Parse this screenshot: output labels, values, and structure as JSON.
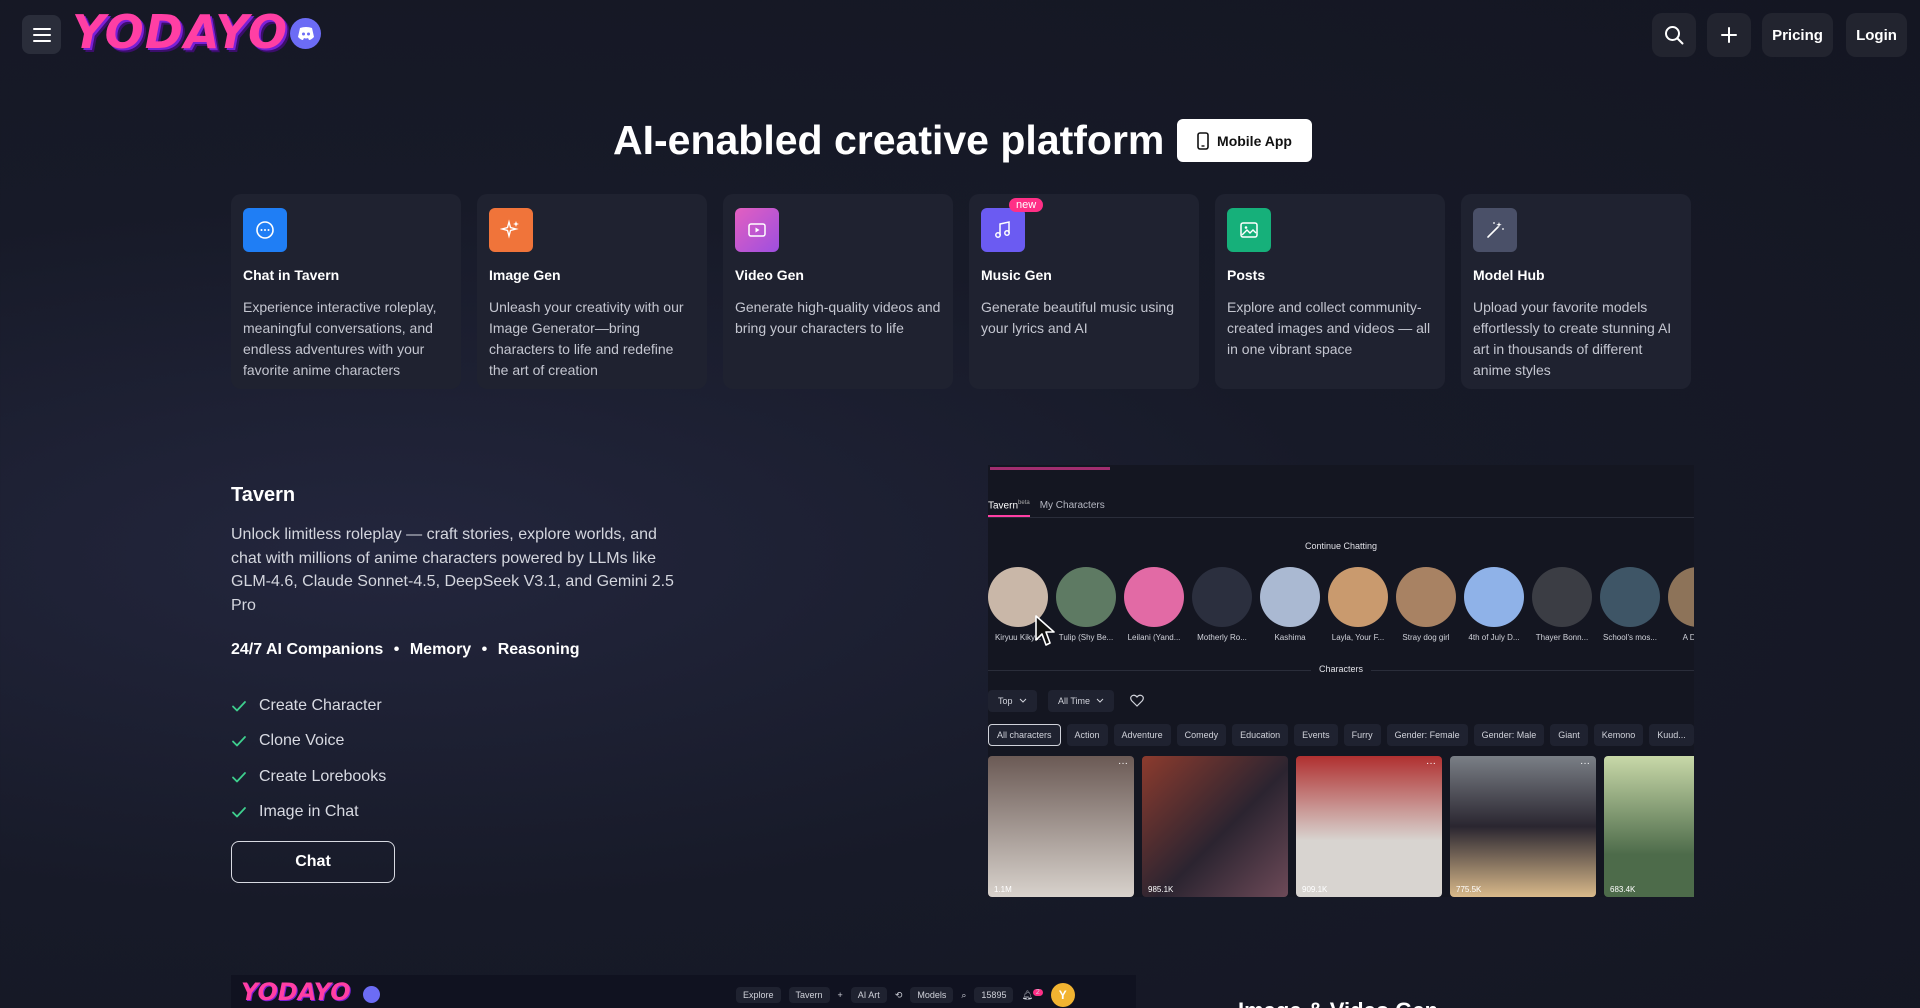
{
  "header": {
    "logo_text": "YODAYO",
    "pricing_label": "Pricing",
    "login_label": "Login"
  },
  "hero": {
    "title": "AI-enabled creative platform",
    "mobile_app_label": "Mobile App"
  },
  "cards": [
    {
      "title": "Chat in Tavern",
      "desc": "Experience interactive roleplay, meaningful conversations, and endless adventures with your favorite anime characters",
      "icon": "chat-bubble-icon",
      "color": "#1f7ef5"
    },
    {
      "title": "Image Gen",
      "desc": "Unleash your creativity with our Image Generator—bring characters to life and redefine the art of creation",
      "icon": "sparkle-icon",
      "color": "#f0743a"
    },
    {
      "title": "Video Gen",
      "desc": "Generate high-quality videos and bring your characters to life",
      "icon": "video-icon",
      "color": "#c94fd8"
    },
    {
      "title": "Music Gen",
      "desc": "Generate beautiful music using your lyrics and AI",
      "icon": "music-note-icon",
      "color": "#6b5bf2",
      "badge": "new"
    },
    {
      "title": "Posts",
      "desc": "Explore and collect community-created images and videos — all in one vibrant space",
      "icon": "image-icon",
      "color": "#16b07a"
    },
    {
      "title": "Model Hub",
      "desc": "Upload your favorite models effortlessly to create stunning AI art in thousands of different anime styles",
      "icon": "magic-wand-icon",
      "color": "#4a5068"
    }
  ],
  "tavern": {
    "title": "Tavern",
    "description": "Unlock limitless roleplay — craft stories, explore worlds, and chat with millions of anime characters powered by LLMs like GLM-4.6, Claude Sonnet-4.5, DeepSeek V3.1, and Gemini 2.5 Pro",
    "features": [
      "24/7 AI Companions",
      "Memory",
      "Reasoning"
    ],
    "checklist": [
      "Create Character",
      "Clone Voice",
      "Create Lorebooks",
      "Image in Chat"
    ],
    "chat_label": "Chat"
  },
  "preview": {
    "tabs": [
      "Tavern",
      "My Characters"
    ],
    "tab_beta": "beta",
    "continue_label": "Continue Chatting",
    "characters_label": "Characters",
    "avatars": [
      {
        "name": "Kiryuu Kiky...",
        "color": "#c9b7a8"
      },
      {
        "name": "Tulip (Shy Be...",
        "color": "#5e7a63"
      },
      {
        "name": "Leilani (Yand...",
        "color": "#e26aa5"
      },
      {
        "name": "Motherly Ro...",
        "color": "#2b2f3e"
      },
      {
        "name": "Kashima",
        "color": "#aab9d2"
      },
      {
        "name": "Layla, Your F...",
        "color": "#c99a6e"
      },
      {
        "name": "Stray dog girl",
        "color": "#a88263"
      },
      {
        "name": "4th of July D...",
        "color": "#8fb2e8"
      },
      {
        "name": "Thayer Bonn...",
        "color": "#3b3d44"
      },
      {
        "name": "School's mos...",
        "color": "#3e5566"
      },
      {
        "name": "A Dete...",
        "color": "#8d7359"
      }
    ],
    "filters": [
      "Top",
      "All Time"
    ],
    "categories": [
      "All characters",
      "Action",
      "Adventure",
      "Comedy",
      "Education",
      "Events",
      "Furry",
      "Gender: Female",
      "Gender: Male",
      "Giant",
      "Kemono",
      "Kuud..."
    ],
    "grid": [
      {
        "count": "1.1M",
        "color": "#8a7a76"
      },
      {
        "count": "985.1K",
        "color": "#6b4b46"
      },
      {
        "count": "909.1K",
        "color": "#9e3b3b"
      },
      {
        "count": "775.5K",
        "color": "#3c3a40"
      },
      {
        "count": "683.4K",
        "color": "#8a9e7a"
      }
    ]
  },
  "bottom_strip": {
    "logo_text": "YODAYO",
    "nav": [
      "Explore",
      "Tavern",
      "+",
      "AI Art",
      "Models",
      "15895"
    ],
    "notif_count": "2",
    "avatar_letter": "Y"
  },
  "bottom_heading": "Image & Video Gen"
}
